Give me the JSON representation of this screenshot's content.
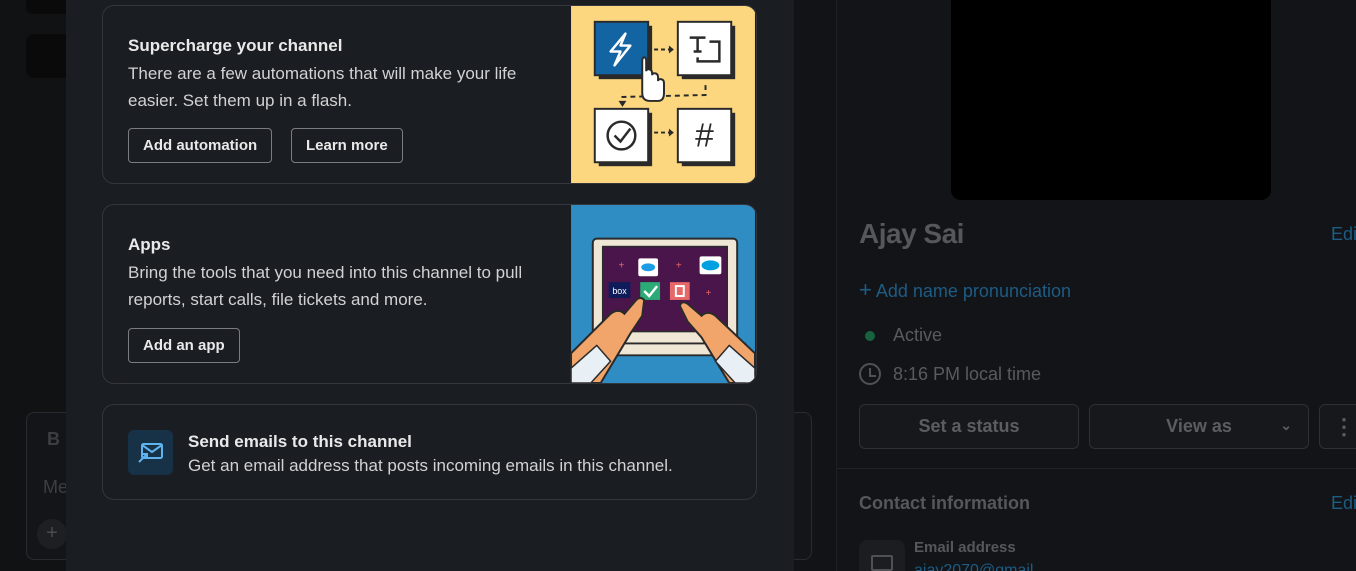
{
  "background": {
    "composer": {
      "bold_button": "B",
      "placeholder_fragment": "Me",
      "plus": "+"
    },
    "profile": {
      "name": "Ajay Sai",
      "edit_label": "Edi",
      "add_pronunciation": "Add name pronunciation",
      "status": "Active",
      "local_time": "8:16 PM local time",
      "set_status_button": "Set a status",
      "view_as_button": "View as",
      "more_button": "⋮",
      "contact_heading": "Contact information",
      "contact_edit_label": "Edi",
      "email_label": "Email address",
      "email_value": "ajay2070@gmail..."
    }
  },
  "modal": {
    "cards": [
      {
        "title": "Supercharge your channel",
        "description": "There are a few automations that will make your life easier. Set them up in a flash.",
        "buttons": [
          "Add automation",
          "Learn more"
        ]
      },
      {
        "title": "Apps",
        "description": "Bring the tools that you need into this channel to pull reports, start calls, file tickets and more.",
        "buttons": [
          "Add an app"
        ]
      },
      {
        "title": "Send emails to this channel",
        "description": "Get an email address that posts incoming emails in this channel."
      }
    ],
    "illustration_labels": {
      "hash": "#",
      "box": "box"
    }
  },
  "colors": {
    "modal_bg": "#1a1d21",
    "card_border": "#34363b",
    "automation_bg": "#fcd77f",
    "automation_accent": "#1264a3",
    "apps_bg": "#2f8dc4",
    "laptop_screen": "#4a154b",
    "link_blue": "#1d5c85",
    "presence_green": "#17633f"
  }
}
